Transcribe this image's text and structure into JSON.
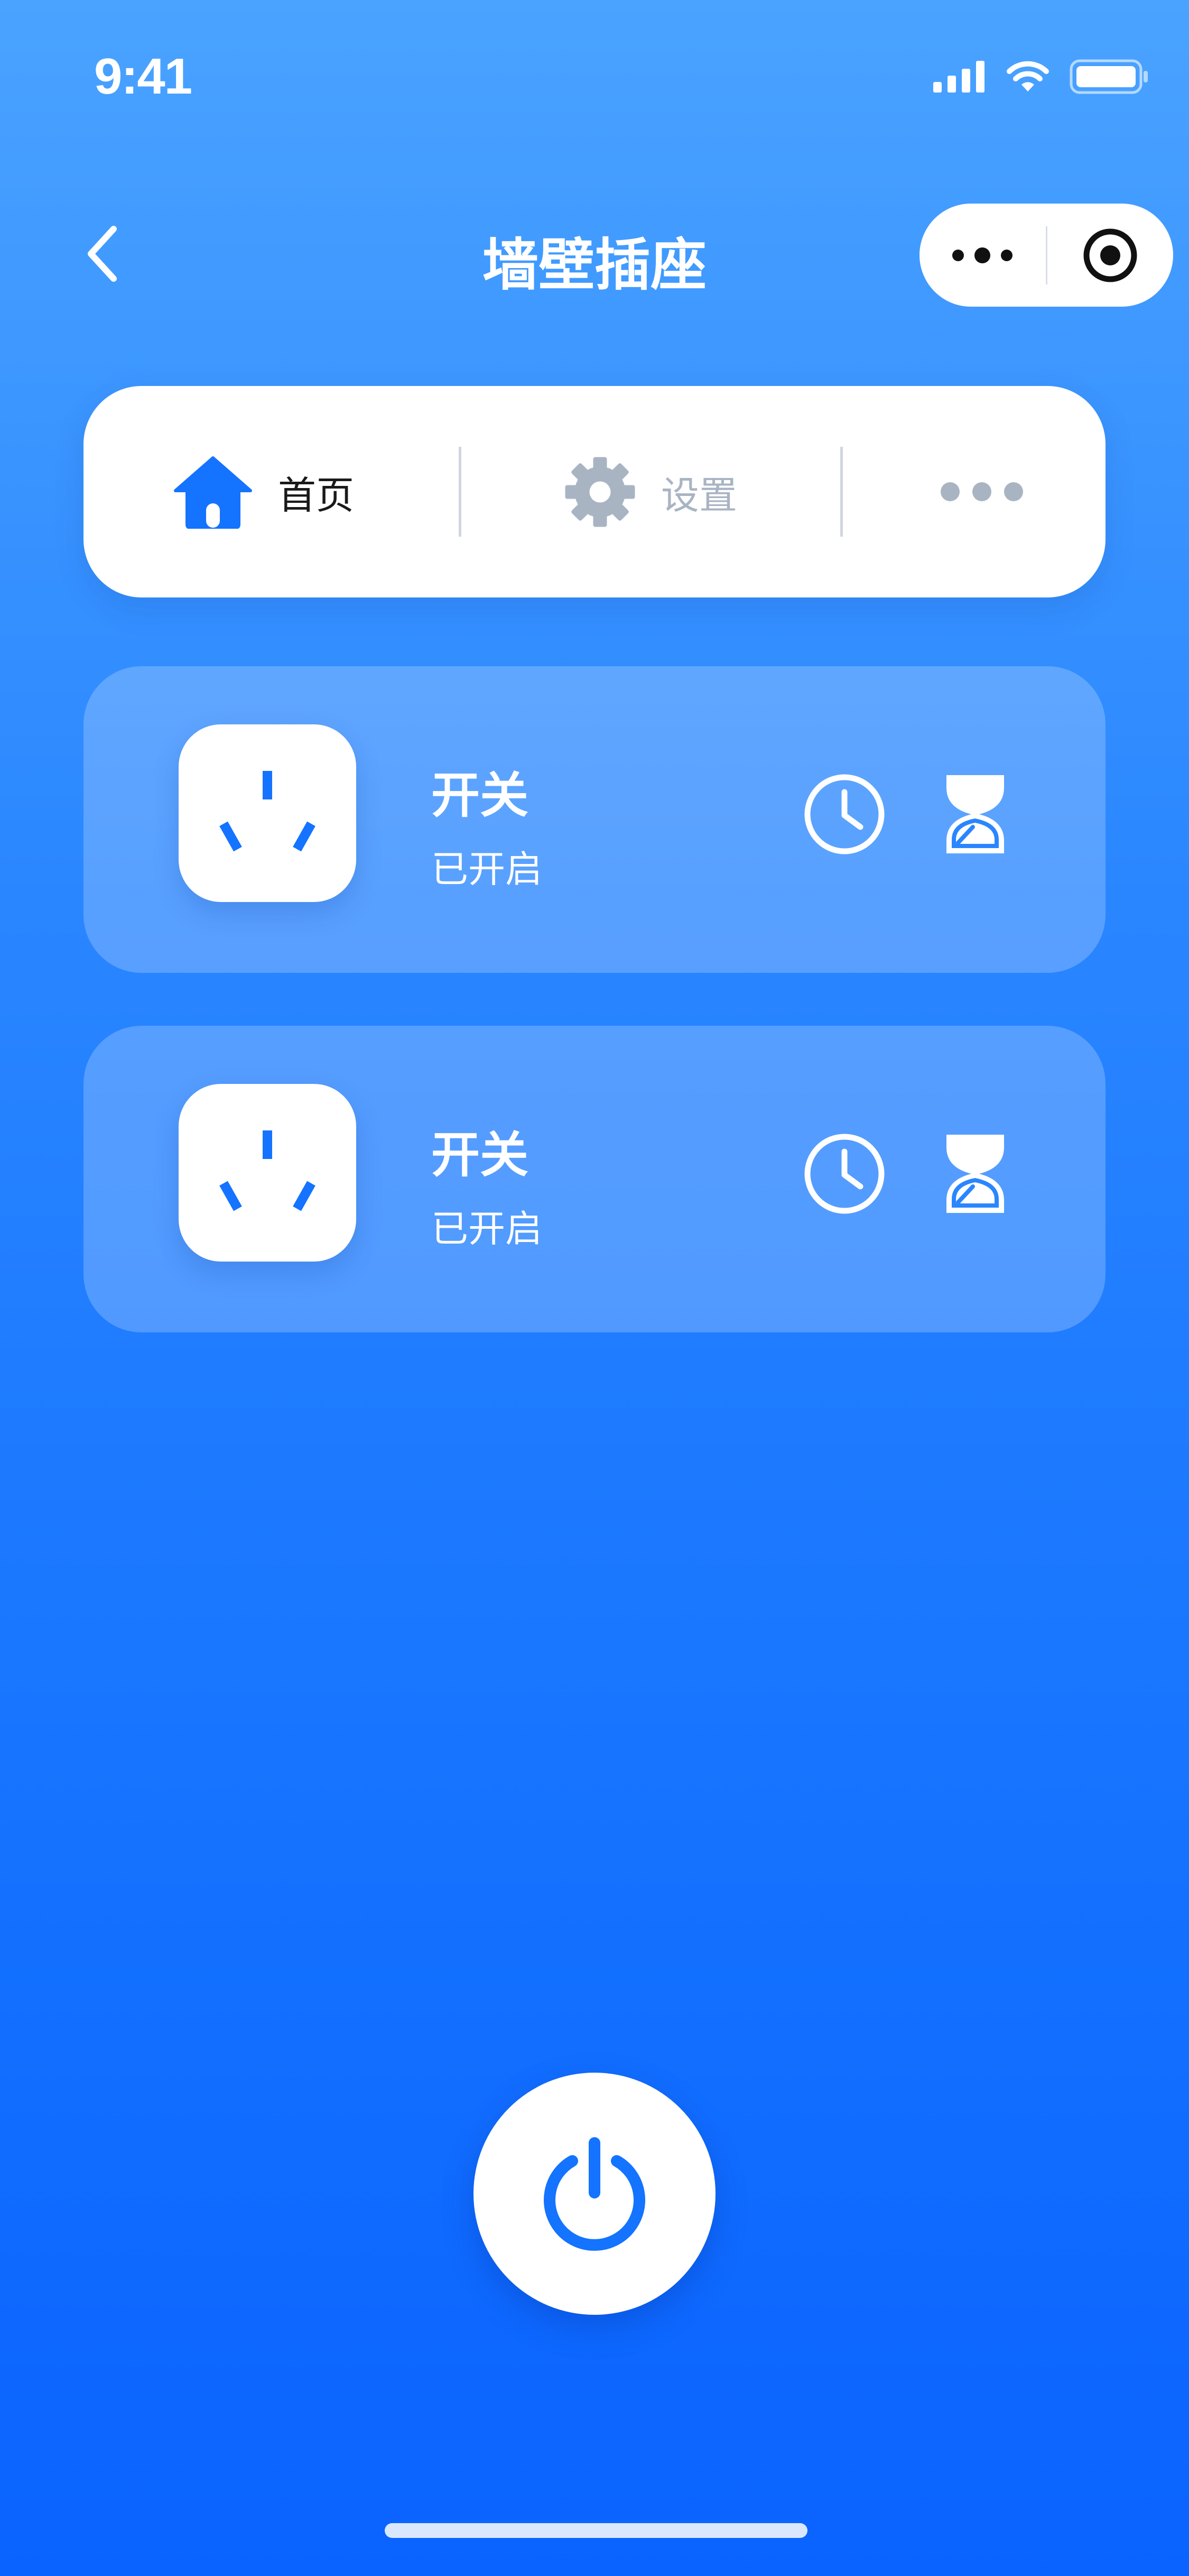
{
  "status_bar": {
    "time": "9:41",
    "icons": [
      "signal-icon",
      "wifi-icon",
      "battery-icon"
    ]
  },
  "nav": {
    "title": "墙壁插座",
    "back_icon": "chevron-left-icon",
    "capsule_icons": [
      "more-dots-icon",
      "target-icon"
    ]
  },
  "tabs": [
    {
      "label": "首页",
      "icon": "home-icon",
      "active": true
    },
    {
      "label": "设置",
      "icon": "gear-icon",
      "active": false
    },
    {
      "label": "",
      "icon": "more-dots-icon",
      "active": false
    }
  ],
  "sockets": [
    {
      "name": "开关",
      "status": "已开启",
      "icon": "socket-icon",
      "actions": [
        "clock-icon",
        "hourglass-icon"
      ]
    },
    {
      "name": "开关",
      "status": "已开启",
      "icon": "socket-icon",
      "actions": [
        "clock-icon",
        "hourglass-icon"
      ]
    }
  ],
  "power_button": {
    "icon": "power-icon"
  },
  "colors": {
    "accent": "#1473ff",
    "gradient_top": "#4aa3ff",
    "gradient_bottom": "#0a63ff",
    "inactive_tab": "#a9b4c3"
  }
}
